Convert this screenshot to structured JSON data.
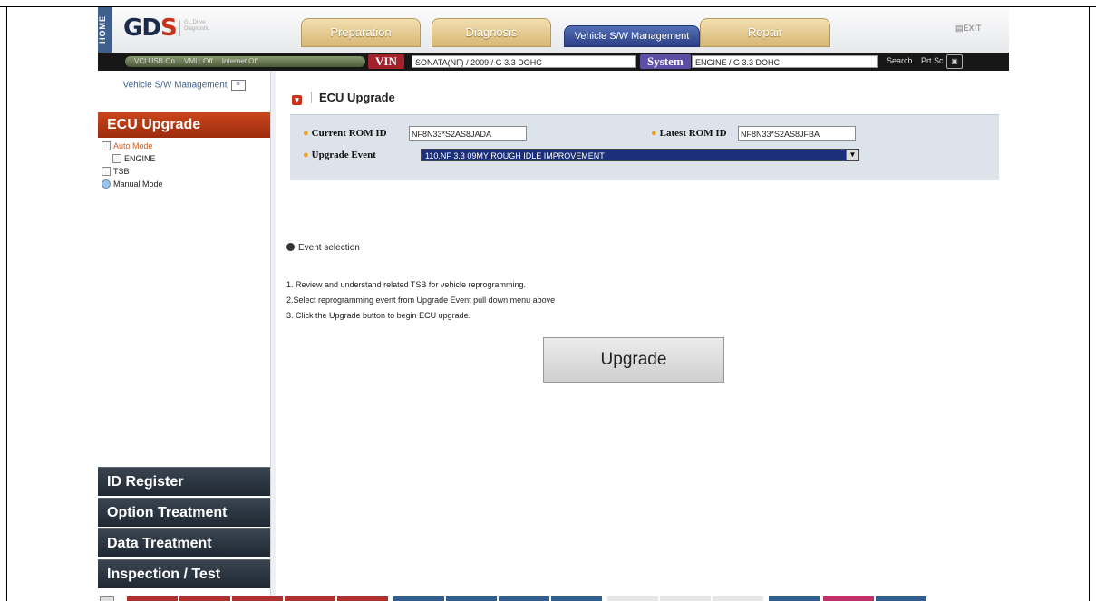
{
  "header": {
    "home_label": "HOME",
    "logo_text": "GD",
    "logo_mark": "S",
    "logo_tagline": "GL Drive Diagnostic",
    "tabs": [
      {
        "label": "Preparation"
      },
      {
        "label": "Diagnosis"
      },
      {
        "label": "Vehicle S/W Management"
      },
      {
        "label": "Repair"
      }
    ],
    "exit_label": "▤EXIT"
  },
  "status_bar": {
    "vci_usb": "VCI USB On",
    "vmi": "VMI : Off",
    "internet": "Internet Off",
    "vin_label": "VIN",
    "vin_value": "SONATA(NF) / 2009 / G 3.3 DOHC",
    "system_label": "System",
    "system_value": "ENGINE / G 3.3 DOHC",
    "search_label": "Search",
    "prtsc_label": "Prt Sc",
    "prtsc_icon": "camera-icon"
  },
  "sidebar": {
    "title": "Vehicle S/W Management",
    "section": "ECU Upgrade",
    "tree": {
      "auto_mode": "Auto Mode",
      "engine": "ENGINE",
      "tsb": "TSB",
      "manual_mode": "Manual Mode"
    },
    "nav": [
      {
        "label": "ID Register"
      },
      {
        "label": "Option Treatment"
      },
      {
        "label": "Data Treatment"
      },
      {
        "label": "Inspection / Test"
      }
    ]
  },
  "main": {
    "title": "ECU Upgrade",
    "current_rom_label": "Current ROM ID",
    "current_rom_value": "NF8N33*S2AS8JADA",
    "latest_rom_label": "Latest ROM ID",
    "latest_rom_value": "NF8N33*S2AS8JFBA",
    "upgrade_event_label": "Upgrade Event",
    "upgrade_event_value": "110.NF 3.3 09MY ROUGH IDLE IMPROVEMENT",
    "event_selection_label": "Event selection",
    "steps": [
      "1. Review and understand related TSB for vehicle reprogramming.",
      "2.Select reprogramming event from Upgrade Event pull down menu above",
      "3. Click the Upgrade button to begin ECU upgrade."
    ],
    "upgrade_button": "Upgrade"
  },
  "colors": {
    "accent_red": "#c8341b",
    "nav_dark": "#2a333d",
    "tab_gold": "#d6b776",
    "tab_active_blue": "#2c3f85",
    "selected_bg": "#1c2f7a"
  }
}
